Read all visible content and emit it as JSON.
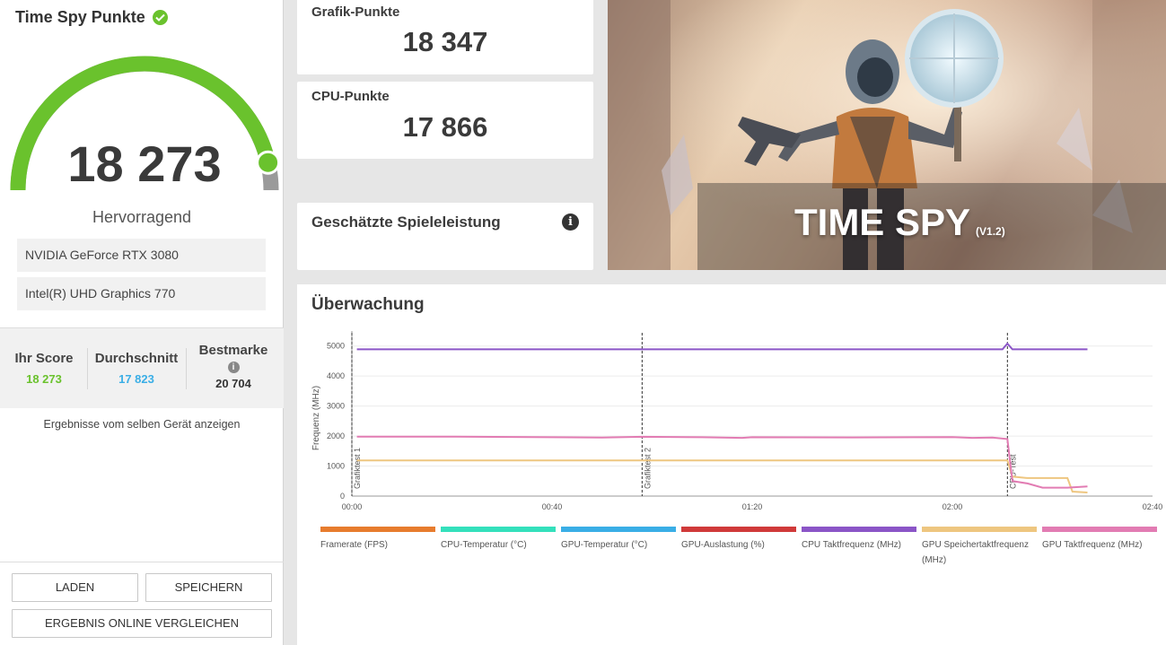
{
  "overall": {
    "title": "Time Spy Punkte",
    "score": "18 273",
    "rating": "Hervorragend",
    "gauge_fraction": 0.93,
    "devices": [
      "NVIDIA GeForce RTX 3080",
      "Intel(R) UHD Graphics 770"
    ]
  },
  "comparison": {
    "your_score_label": "Ihr Score",
    "your_score_value": "18 273",
    "average_label": "Durchschnitt",
    "average_value": "17 823",
    "best_label": "Bestmarke",
    "best_value": "20 704",
    "same_device_link": "Ergebnisse vom selben Gerät anzeigen"
  },
  "buttons": {
    "load": "LADEN",
    "save": "SPEICHERN",
    "compare_online": "ERGEBNIS ONLINE VERGLEICHEN"
  },
  "graphics_card": {
    "label": "Grafik-Punkte",
    "value": "18 347"
  },
  "cpu_card": {
    "label": "CPU-Punkte",
    "value": "17 866"
  },
  "game_perf": {
    "label": "Geschätzte Spieleleistung"
  },
  "hero": {
    "title": "TIME SPY",
    "version": "(V1.2)"
  },
  "monitoring": {
    "title": "Überwachung",
    "chart_data": {
      "type": "line",
      "ylabel": "Frequenz (MHz)",
      "xlabel": "",
      "x_ticks": [
        "00:00",
        "00:40",
        "01:20",
        "02:00",
        "02:40"
      ],
      "y_ticks": [
        0,
        1000,
        2000,
        3000,
        4000,
        5000
      ],
      "ylim": [
        0,
        5200
      ],
      "xlim_seconds": [
        0,
        160
      ],
      "markers": [
        {
          "label": "Grafiktest 1",
          "t": 0
        },
        {
          "label": "Grafiktest 2",
          "t": 58
        },
        {
          "label": "CPU-Test",
          "t": 131
        }
      ],
      "series": [
        {
          "name": "Framerate (FPS)",
          "color": "#e77c2e",
          "points": []
        },
        {
          "name": "CPU-Temperatur (°C)",
          "color": "#34e0bc",
          "points": []
        },
        {
          "name": "GPU-Temperatur (°C)",
          "color": "#3aaee6",
          "points": []
        },
        {
          "name": "GPU-Auslastung (%)",
          "color": "#d03a3a",
          "points": []
        },
        {
          "name": "CPU Taktfrequenz (MHz)",
          "color": "#8b55c7",
          "points": [
            [
              1,
              4890
            ],
            [
              40,
              4890
            ],
            [
              80,
              4890
            ],
            [
              120,
              4890
            ],
            [
              130,
              4890
            ],
            [
              131,
              5080
            ],
            [
              132,
              4890
            ],
            [
              140,
              4890
            ],
            [
              147,
              4890
            ]
          ]
        },
        {
          "name": "GPU Speichertaktfrequenz (MHz)",
          "color": "#eec680",
          "points": [
            [
              1,
              1190
            ],
            [
              40,
              1190
            ],
            [
              80,
              1190
            ],
            [
              120,
              1190
            ],
            [
              131,
              1190
            ],
            [
              132,
              650
            ],
            [
              135,
              600
            ],
            [
              143,
              600
            ],
            [
              144,
              150
            ],
            [
              147,
              120
            ]
          ]
        },
        {
          "name": "GPU Taktfrequenz (MHz)",
          "color": "#e27cb3",
          "points": [
            [
              1,
              1980
            ],
            [
              20,
              1980
            ],
            [
              40,
              1960
            ],
            [
              50,
              1950
            ],
            [
              58,
              1975
            ],
            [
              70,
              1960
            ],
            [
              78,
              1940
            ],
            [
              80,
              1960
            ],
            [
              100,
              1955
            ],
            [
              120,
              1965
            ],
            [
              124,
              1940
            ],
            [
              128,
              1950
            ],
            [
              131,
              1900
            ],
            [
              132,
              500
            ],
            [
              135,
              420
            ],
            [
              138,
              280
            ],
            [
              143,
              280
            ],
            [
              147,
              320
            ]
          ]
        }
      ]
    }
  }
}
